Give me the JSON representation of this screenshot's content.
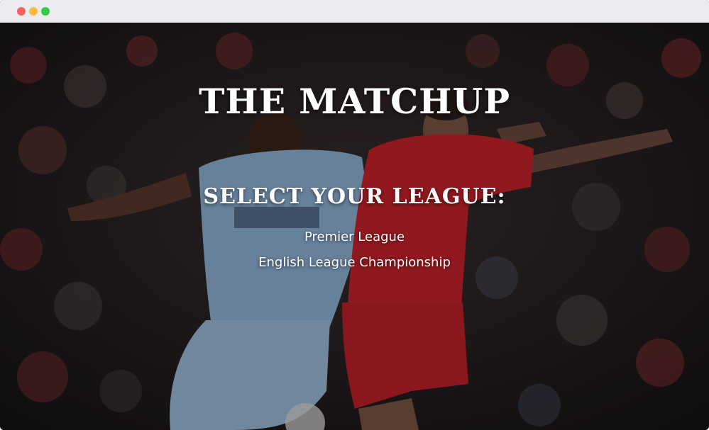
{
  "window": {
    "controls": [
      "close",
      "minimize",
      "zoom"
    ]
  },
  "hero": {
    "background": "photo of two footballers in light blue and red kits contesting the ball in front of a crowd"
  },
  "site_title": "THE MATCHUP",
  "league_heading": "SELECT YOUR LEAGUE:",
  "leagues": [
    {
      "label": "Premier League"
    },
    {
      "label": "English League Championship"
    }
  ],
  "colors": {
    "text": "#ffffff",
    "kit_light_blue": "#8fb3d6",
    "kit_red": "#c8232c"
  }
}
